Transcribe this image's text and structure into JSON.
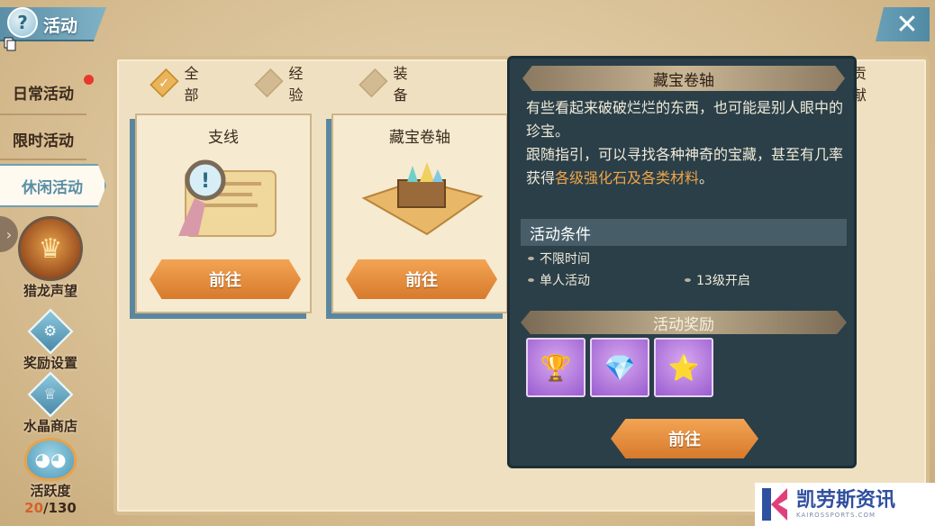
{
  "app": {
    "title": "活动",
    "help_icon": "?",
    "close_icon": "✕"
  },
  "nav": {
    "items": [
      {
        "label": "日常活动",
        "has_badge": true
      },
      {
        "label": "限时活动"
      },
      {
        "label": "休闲活动",
        "active": true
      }
    ],
    "side_buttons": [
      {
        "label": "猎龙声望",
        "icon": "dragon-emblem-icon"
      },
      {
        "label": "奖励设置",
        "icon": "gear-icon"
      },
      {
        "label": "水晶商店",
        "icon": "crystal-shop-icon"
      },
      {
        "label": "活跃度",
        "icon": "mascot-icon"
      }
    ],
    "activity": {
      "current": "20",
      "total": "/130"
    }
  },
  "filters": [
    {
      "label": "全部",
      "selected": true
    },
    {
      "label": "经验"
    },
    {
      "label": "装备"
    },
    {
      "label": "贡献"
    }
  ],
  "cards": [
    {
      "title": "支线",
      "button": "前往",
      "art": "quest-scroll-magnifier"
    },
    {
      "title": "藏宝卷轴",
      "button": "前往",
      "art": "treasure-map-chest"
    }
  ],
  "detail": {
    "title": "藏宝卷轴",
    "desc_line1": "有些看起来破破烂烂的东西，也可能是别人眼中的珍宝。",
    "desc_line2_pre": "跟随指引，可以寻找各种神奇的宝藏，甚至有几率获得",
    "desc_highlight": "各级强化石及各类材料",
    "desc_line2_post": "。",
    "conditions_title": "活动条件",
    "conditions": [
      "不限时间",
      "单人活动",
      "13级开启"
    ],
    "rewards_title": "活动奖励",
    "rewards": [
      "golden-chest-icon",
      "blue-crystal-icon",
      "gold-star-icon"
    ],
    "button": "前往"
  },
  "watermark": {
    "title": "凯劳斯资讯",
    "subtitle": "KAIROSSPORTS.COM"
  },
  "colors": {
    "accent_orange": "#d77a2c",
    "highlight_text": "#f0a44a",
    "nav_active": "#5a8ea5",
    "reward_bg": "#9a5ccf"
  }
}
